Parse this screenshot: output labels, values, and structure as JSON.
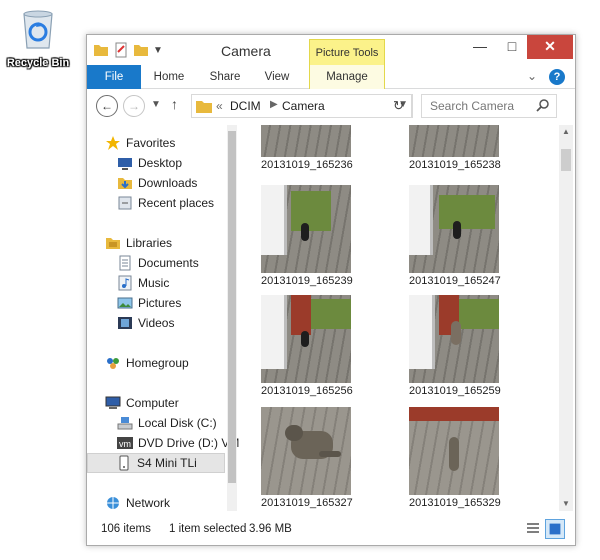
{
  "desktop": {
    "recycle_bin_label": "Recycle Bin"
  },
  "window": {
    "title": "Camera",
    "contextual_tab_group": "Picture Tools",
    "ribbon_tabs": {
      "file": "File",
      "home": "Home",
      "share": "Share",
      "view": "View",
      "manage": "Manage"
    }
  },
  "nav": {
    "breadcrumb_prefix": "«",
    "breadcrumbs": [
      "DCIM",
      "Camera"
    ],
    "search_placeholder": "Search Camera"
  },
  "sidebar": {
    "items": [
      {
        "label": "Favorites",
        "icon": "star-icon"
      },
      {
        "label": "Desktop",
        "icon": "desktop-icon"
      },
      {
        "label": "Downloads",
        "icon": "downloads-icon"
      },
      {
        "label": "Recent places",
        "icon": "recent-places-icon"
      },
      {
        "label": "Libraries",
        "icon": "libraries-icon"
      },
      {
        "label": "Documents",
        "icon": "documents-icon"
      },
      {
        "label": "Music",
        "icon": "music-icon"
      },
      {
        "label": "Pictures",
        "icon": "pictures-icon"
      },
      {
        "label": "Videos",
        "icon": "videos-icon"
      },
      {
        "label": "Homegroup",
        "icon": "homegroup-icon"
      },
      {
        "label": "Computer",
        "icon": "computer-icon"
      },
      {
        "label": "Local Disk (C:)",
        "icon": "drive-icon"
      },
      {
        "label": "DVD Drive (D:) VM",
        "icon": "dvd-icon"
      },
      {
        "label": "S4 Mini TLi",
        "icon": "phone-icon"
      },
      {
        "label": "Network",
        "icon": "network-icon"
      }
    ]
  },
  "files": [
    {
      "name": "20131019_165236"
    },
    {
      "name": "20131019_165238"
    },
    {
      "name": "20131019_165239"
    },
    {
      "name": "20131019_165247"
    },
    {
      "name": "20131019_165256"
    },
    {
      "name": "20131019_165259"
    },
    {
      "name": "20131019_165327"
    },
    {
      "name": "20131019_165329"
    }
  ],
  "status": {
    "item_count": "106 items",
    "selection": "1 item selected",
    "selection_size": "3.96 MB"
  },
  "colors": {
    "file_tab": "#1979ca",
    "contextual_tab": "#fbf28a",
    "close_button": "#c9463d"
  }
}
